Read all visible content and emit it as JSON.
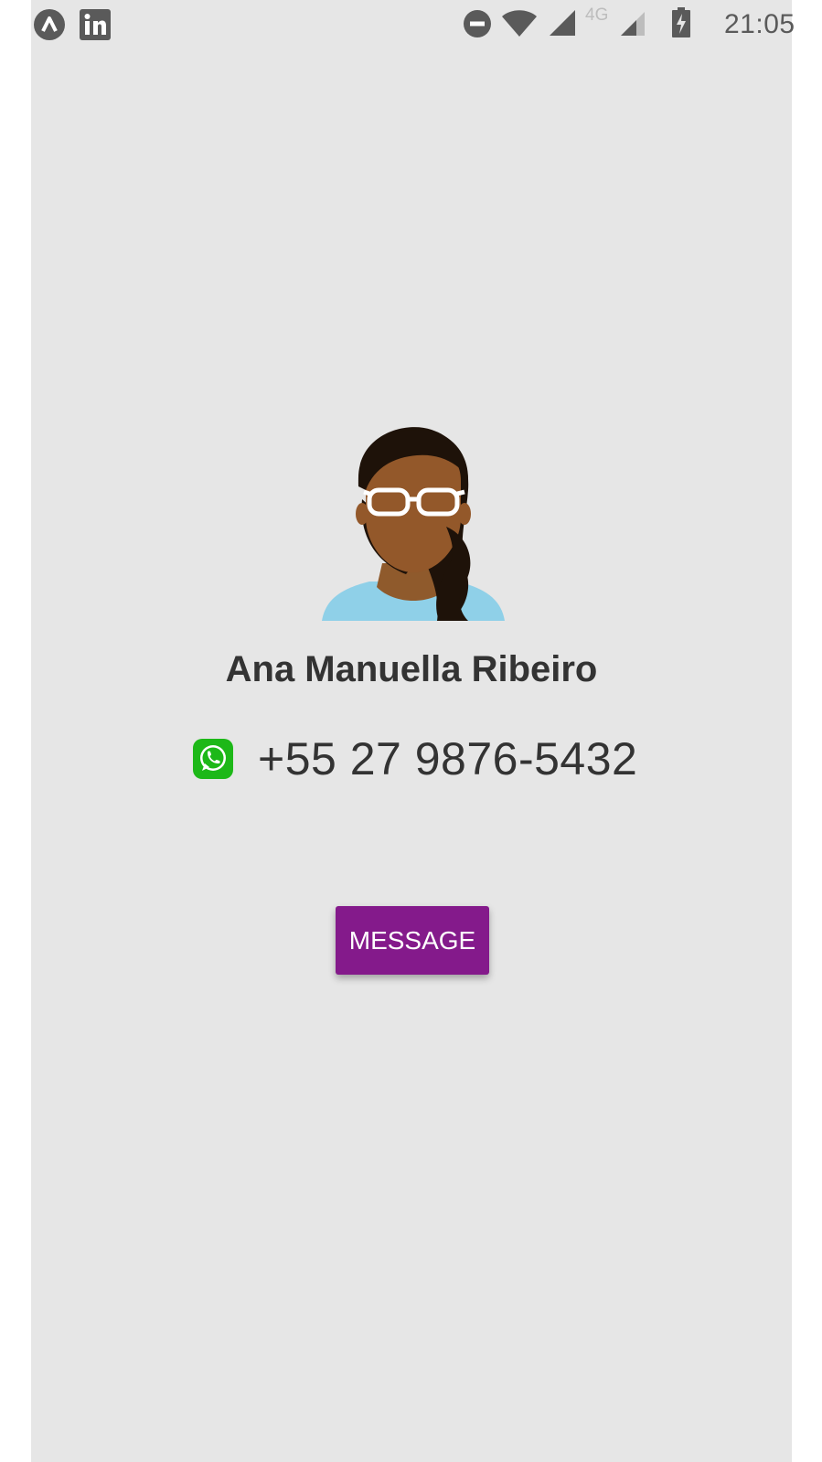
{
  "status_bar": {
    "time": "21:05",
    "network_type": "4G",
    "left_icons": [
      "app-launcher-icon",
      "linkedin-icon"
    ],
    "right_icons": [
      "do-not-disturb-icon",
      "wifi-icon",
      "signal-icon",
      "signal-4g-icon",
      "battery-charging-icon"
    ]
  },
  "contact": {
    "name": "Ana Manuella Ribeiro",
    "phone": "+55 27 9876-5432",
    "phone_icon": "whatsapp-icon",
    "avatar_icon": "avatar-woman-glasses"
  },
  "actions": {
    "message_label": "MESSAGE"
  },
  "colors": {
    "background": "#e6e6e6",
    "accent": "#841a8b",
    "text": "#333333",
    "whatsapp": "#1db818"
  }
}
